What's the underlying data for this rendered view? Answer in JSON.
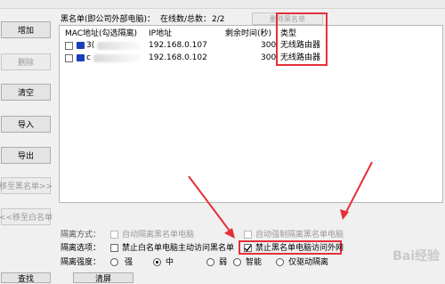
{
  "header": {
    "title": "黑名单(即公司外部电脑)：",
    "count_label": "在线数/总数：",
    "count_value": "2/2",
    "delete_label": "删除黑名单"
  },
  "sidebar": {
    "items": [
      {
        "label": "增加",
        "enabled": true
      },
      {
        "label": "删除",
        "enabled": false
      },
      {
        "label": "清空",
        "enabled": true
      },
      {
        "label": "导入",
        "enabled": true
      },
      {
        "label": "导出",
        "enabled": true
      },
      {
        "label": "移至黑名单>>",
        "enabled": false
      },
      {
        "label": "<<移至白名单",
        "enabled": false
      }
    ]
  },
  "table": {
    "columns": [
      "MAC地址(勾选隔离)",
      "IP地址",
      "剩余时间(秒)",
      "类型"
    ],
    "rows": [
      {
        "mac": "3(",
        "ip": "192.168.0.107",
        "remaining": "300",
        "type": "无线路由器"
      },
      {
        "mac": "c",
        "ip": "192.168.0.102",
        "remaining": "300",
        "type": "无线路由器"
      }
    ]
  },
  "options": {
    "mode_label": "隔离方式：",
    "mode_auto_isolate": "自动隔离黑名单电脑",
    "mode_force_isolate": "自动强制隔离黑名单电脑",
    "select_label": "隔离选项：",
    "forbid_white": "禁止白名单电脑主动访问黑名单",
    "forbid_black": "禁止黑名单电脑访问外网",
    "forbid_black_checked": true,
    "strength_label": "隔离强度：",
    "strength_options": [
      "强",
      "中",
      "弱",
      "智能",
      "仅驱动隔离"
    ],
    "strength_selected": "中"
  },
  "footer": {
    "find_label": "查找",
    "clear_label": "清屏"
  },
  "watermark": "Bai经验",
  "colors": {
    "annotation_red": "#e5303a",
    "pc_icon_blue": "#1a3fb8"
  }
}
